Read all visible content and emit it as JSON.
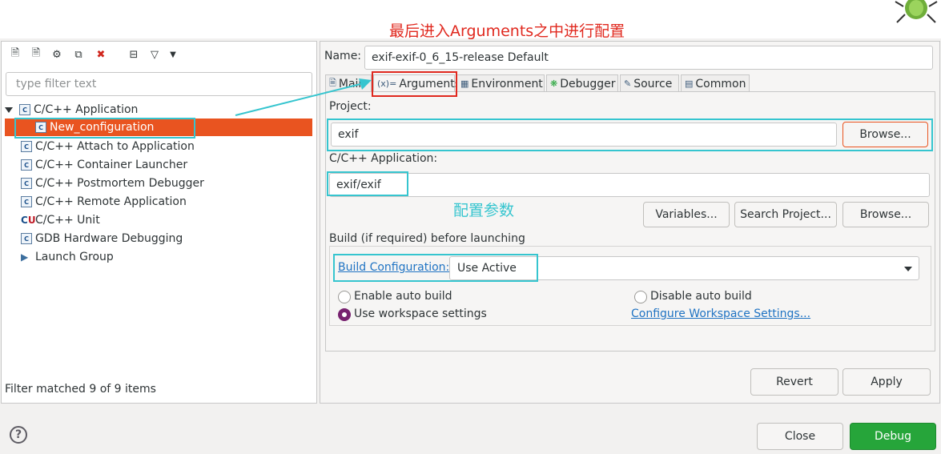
{
  "annotations": {
    "title": "最后进入Arguments之中进行配置",
    "config_params": "配置参数"
  },
  "filter": {
    "placeholder": "type filter text"
  },
  "tree": {
    "items": [
      {
        "label": "C/C++ Application",
        "icon": "c-launch-icon",
        "expanded": true
      },
      {
        "label": "New_configuration",
        "icon": "c-launch-icon",
        "selected": true
      },
      {
        "label": "C/C++ Attach to Application",
        "icon": "c-launch-icon"
      },
      {
        "label": "C/C++ Container Launcher",
        "icon": "c-launch-icon"
      },
      {
        "label": "C/C++ Postmortem Debugger",
        "icon": "c-launch-icon"
      },
      {
        "label": "C/C++ Remote Application",
        "icon": "c-launch-icon"
      },
      {
        "label": "C/C++ Unit",
        "icon": "c-unit-icon"
      },
      {
        "label": "GDB Hardware Debugging",
        "icon": "c-launch-icon"
      },
      {
        "label": "Launch Group",
        "icon": "launch-group-icon"
      }
    ],
    "status": "Filter matched 9 of 9 items"
  },
  "config": {
    "name_label": "Name:",
    "name_value": "exif-exif-0_6_15-release Default",
    "tabs": [
      "Main",
      "Arguments",
      "Environment",
      "Debugger",
      "Source",
      "Common"
    ],
    "project_label": "Project:",
    "project_value": "exif",
    "browse_label": "Browse...",
    "app_label": "C/C++ Application:",
    "app_value": "exif/exif",
    "variables_label": "Variables...",
    "search_project_label": "Search Project...",
    "browse2_label": "Browse...",
    "build_group_label": "Build (if required) before launching",
    "build_config_link": "Build Configuration:",
    "build_config_value": "Use Active",
    "enable_auto": "Enable auto build",
    "disable_auto": "Disable auto build",
    "use_workspace": "Use workspace settings",
    "configure_link": "Configure Workspace Settings...",
    "revert": "Revert",
    "apply": "Apply"
  },
  "footer": {
    "help": "?",
    "close": "Close",
    "debug": "Debug"
  },
  "colors": {
    "selection": "#e95420",
    "annotation_cyan": "#36c5cf",
    "annotation_red": "#e0281e",
    "debug": "#26a53a"
  }
}
